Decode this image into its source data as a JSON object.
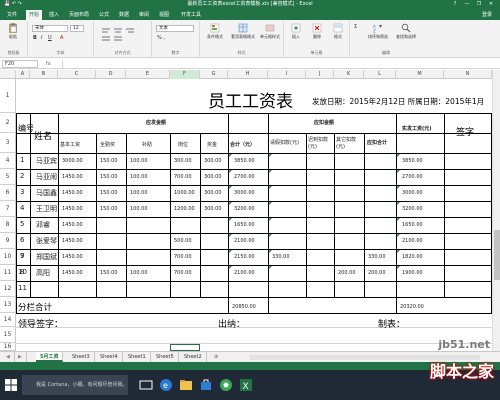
{
  "window": {
    "title": "最新员工工资表excel工资表模板.xls  [兼容模式] - Excel",
    "controls": [
      "?",
      "—",
      "❐",
      "✕"
    ]
  },
  "ribbon": {
    "tabs": [
      "文件",
      "开始",
      "插入",
      "页面布局",
      "公式",
      "数据",
      "审阅",
      "视图",
      "开发工具"
    ],
    "active_tab": "开始",
    "signin": "登录",
    "paste_label": "粘贴",
    "font_name": "宋体",
    "font_size": "12",
    "number_format": "文本",
    "buttons": [
      "条件格式",
      "套用表格格式",
      "单元格样式",
      "插入",
      "删除",
      "格式",
      "排序和筛选",
      "查找和选择"
    ],
    "groups": [
      "剪贴板",
      "字体",
      "对齐方式",
      "数字",
      "样式",
      "单元格",
      "编辑"
    ]
  },
  "formula_bar": {
    "name_box": "F20",
    "fx": "fx",
    "value": ""
  },
  "grid": {
    "columns": [
      "A",
      "B",
      "C",
      "D",
      "E",
      "F",
      "G",
      "H",
      "I",
      "J",
      "K",
      "L",
      "M",
      "N"
    ],
    "selected_column": "F",
    "rows": [
      "1",
      "2",
      "3",
      "4",
      "5",
      "6",
      "7",
      "8",
      "9",
      "10",
      "11",
      "12",
      "13",
      "14",
      "15",
      "16",
      "17",
      "18",
      "19",
      "20"
    ],
    "selected_row": "20"
  },
  "sheet": {
    "title": "员工工资表",
    "issue_date": "发放日期：2015年2月12日 所属日期：2015年1月",
    "col_no": "编号",
    "col_name": "姓名",
    "group_payable": "应发金额",
    "group_deduct": "应扣金额",
    "sub_headers": {
      "base": "基本工资",
      "attendance": "全勤奖",
      "subsidy": "补助",
      "post": "岗位",
      "bonus": "奖金",
      "payable_total": "合计（元）",
      "leave": "请假扣款(元)",
      "late": "迟到扣款(元)",
      "other": "其它扣款(元)",
      "deduct_total": "应扣合计",
      "net": "实发工资(元)",
      "sign": "签字"
    },
    "employees": [
      {
        "no": "1",
        "name": "马亚宾",
        "base": "3000.00",
        "attendance": "150.00",
        "subsidy": "100.00",
        "post": "300.00",
        "bonus": "300.00",
        "total": "3850.00",
        "leave": "",
        "late": "",
        "other": "",
        "deduct": "",
        "net": "3850.00"
      },
      {
        "no": "2",
        "name": "马亚闹",
        "base": "1450.00",
        "attendance": "150.00",
        "subsidy": "100.00",
        "post": "700.00",
        "bonus": "300.00",
        "total": "2700.00",
        "leave": "",
        "late": "",
        "other": "",
        "deduct": "",
        "net": "2700.00"
      },
      {
        "no": "3",
        "name": "马国鑫",
        "base": "1450.00",
        "attendance": "150.00",
        "subsidy": "100.00",
        "post": "1000.00",
        "bonus": "300.00",
        "total": "3000.00",
        "leave": "",
        "late": "",
        "other": "",
        "deduct": "",
        "net": "3000.00"
      },
      {
        "no": "4",
        "name": "王卫明",
        "base": "1450.00",
        "attendance": "150.00",
        "subsidy": "100.00",
        "post": "1200.00",
        "bonus": "300.00",
        "total": "3200.00",
        "leave": "",
        "late": "",
        "other": "",
        "deduct": "",
        "net": "3200.00"
      },
      {
        "no": "5",
        "name": "邓睿",
        "base": "1450.00",
        "attendance": "",
        "subsidy": "",
        "post": "",
        "bonus": "",
        "total": "1650.00",
        "leave": "",
        "late": "",
        "other": "",
        "deduct": "",
        "net": "1650.00"
      },
      {
        "no": "6",
        "name": "张爱琴",
        "base": "1450.00",
        "attendance": "",
        "subsidy": "",
        "post": "500.00",
        "bonus": "",
        "total": "2100.00",
        "leave": "",
        "late": "",
        "other": "",
        "deduct": "",
        "net": "2100.00"
      },
      {
        "no": "7",
        "name": "郑国斌",
        "base": "1450.00",
        "attendance": "",
        "subsidy": "",
        "post": "700.00",
        "bonus": "",
        "total": "2150.00",
        "leave": "330.00",
        "late": "",
        "other": "",
        "deduct": "330.00",
        "net": "1820.00"
      },
      {
        "no": "8",
        "name": "高阳",
        "base": "1450.00",
        "attendance": "150.00",
        "subsidy": "100.00",
        "post": "700.00",
        "bonus": "",
        "total": "2100.00",
        "leave": "",
        "late": "",
        "other": "200.00",
        "deduct": "200.00",
        "net": "1900.00"
      }
    ],
    "extra_nos": [
      "9",
      "10",
      "11"
    ],
    "sum_label": "分栏合计",
    "sum_total": "20850.00",
    "sum_net": "20320.00",
    "footer": {
      "leader": "领导签字：",
      "cashier": "出纳：",
      "maker": "制表："
    }
  },
  "sheet_tabs": [
    "5月工资",
    "Sheet3",
    "Sheet4",
    "Sheet1",
    "Sheet5",
    "Sheet2"
  ],
  "active_sheet": "5月工资",
  "taskbar": {
    "search_placeholder": "我是 Cortana，小娜。有问题尽管问我。"
  },
  "watermark": {
    "url": "jb51.net",
    "name": "脚本之家"
  },
  "colors": {
    "excel_green": "#217346",
    "marker_green": "#2e8b57",
    "taskbar": "#1f2a36"
  }
}
